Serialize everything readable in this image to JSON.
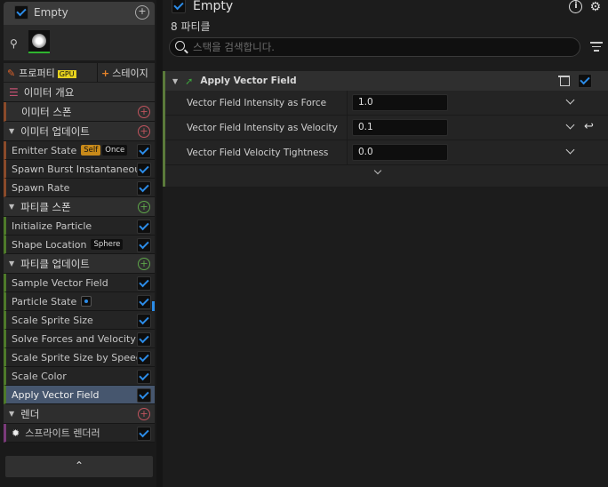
{
  "emitter": {
    "name": "Empty",
    "properties_tab": "프로퍼티",
    "gpu_badge": "GPU",
    "stage_tab": "스테이지"
  },
  "stack": {
    "overview": "이미터 개요",
    "emitter_spawn": "이미터 스폰",
    "emitter_update": {
      "label": "이미터 업데이트",
      "items": [
        {
          "label": "Emitter State",
          "tag1": "Self",
          "tag2": "Once"
        },
        {
          "label": "Spawn Burst Instantaneous"
        },
        {
          "label": "Spawn Rate"
        }
      ]
    },
    "particle_spawn": {
      "label": "파티클 스폰",
      "items": [
        {
          "label": "Initialize Particle"
        },
        {
          "label": "Shape Location",
          "tag": "Sphere"
        }
      ]
    },
    "particle_update": {
      "label": "파티클 업데이트",
      "items": [
        {
          "label": "Sample Vector Field"
        },
        {
          "label": "Particle State"
        },
        {
          "label": "Scale Sprite Size"
        },
        {
          "label": "Solve Forces and Velocity"
        },
        {
          "label": "Scale Sprite Size by Speed"
        },
        {
          "label": "Scale Color"
        },
        {
          "label": "Apply Vector Field",
          "selected": true
        }
      ]
    },
    "render": {
      "label": "렌더",
      "items": [
        {
          "label": "스프라이트 렌더러"
        }
      ]
    },
    "collapse_glyph": "⌃"
  },
  "details": {
    "title": "Empty",
    "count": "8 파티클",
    "search_placeholder": "스택을 검색합니다.",
    "module": {
      "name": "Apply Vector Field",
      "props": [
        {
          "name": "Vector Field Intensity as Force",
          "value": "1.0"
        },
        {
          "name": "Vector Field Intensity as Velocity",
          "value": "0.1"
        },
        {
          "name": "Vector Field Velocity Tightness",
          "value": "0.0"
        }
      ]
    }
  },
  "colors": {
    "accent": "#2c8ce8",
    "selected_row": "#46566e",
    "self_tag": "#c88a1a",
    "gpu_tag": "#e6d21e",
    "add_red": "#c0545e",
    "add_green": "#5ea64a"
  },
  "icons": [
    "checkbox-icon",
    "menu-plus-icon",
    "pin-icon",
    "pencil-icon",
    "add-icon",
    "caret-down-icon",
    "list-icon",
    "arrow-icon",
    "trash-icon",
    "info-icon",
    "gear-icon",
    "search-icon",
    "filter-icon",
    "chevron-down-icon",
    "reset-icon",
    "chevron-up-icon",
    "sprite-renderer-icon"
  ]
}
